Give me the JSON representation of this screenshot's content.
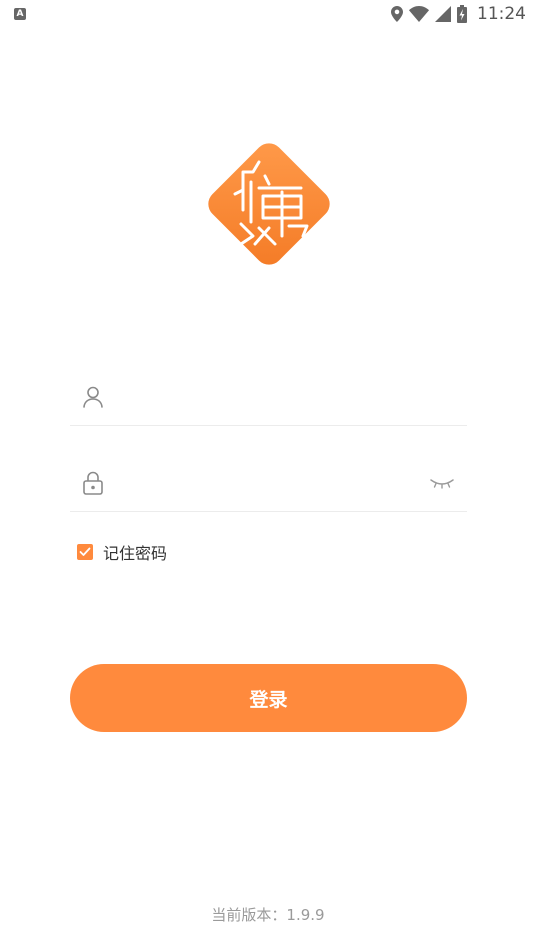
{
  "status_bar": {
    "time": "11:24",
    "indicator_letter": "A",
    "icons": [
      "location-icon",
      "wifi-icon",
      "signal-icon",
      "battery-icon"
    ]
  },
  "logo": {
    "icon": "brand-logo-icon",
    "color": "#ff8a3d"
  },
  "form": {
    "username": {
      "icon": "user-icon",
      "value": "",
      "placeholder": ""
    },
    "password": {
      "icon": "lock-icon",
      "value": "",
      "placeholder": "",
      "toggle_icon": "eye-closed-icon"
    },
    "remember": {
      "label": "记住密码",
      "checked": true
    },
    "login_label": "登录"
  },
  "version_text": "当前版本：1.9.9",
  "colors": {
    "accent": "#ff8a3d",
    "divider": "#ececec",
    "muted": "#9a9a9a"
  }
}
